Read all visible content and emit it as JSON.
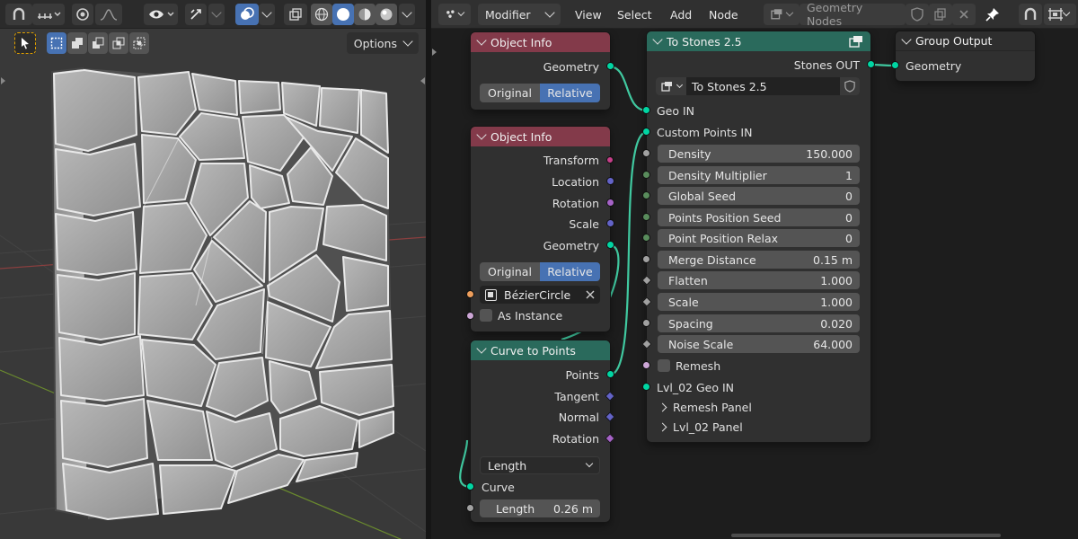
{
  "viewport": {
    "options_label": "Options",
    "colors": {
      "bg": "#393939",
      "header": "#2b2b2b",
      "stone": "#a7a7a7",
      "stone_edge": "#e9e9e9",
      "crack": "#404040"
    },
    "header_icons": [
      "magnet-icon",
      "snap-increment-icon",
      "proportional-edit-icon",
      "falloff-icon",
      "view-object-types-icon",
      "gizmo-icon",
      "overlays-icon",
      "xray-icon",
      "wireframe-shading-icon",
      "solid-shading-icon",
      "material-shading-icon",
      "rendered-shading-icon"
    ],
    "tool_icons": [
      "select-cursor-icon",
      "mode-new-icon",
      "mode-extend-icon",
      "mode-subtract-icon",
      "mode-difference-icon",
      "mode-intersect-icon"
    ]
  },
  "node_editor": {
    "header": {
      "editor_type_icon": "node-editor-icon",
      "mode": "Modifier",
      "menus": [
        "View",
        "Select",
        "Add",
        "Node"
      ],
      "node_group": "Geometry Nodes",
      "pin_icon": "pin-icon"
    },
    "colors": {
      "object_info": "#833a4a",
      "geometry": "#2a6a5c",
      "wire": "#40c9a0",
      "geometry_socket": "#00d6a3",
      "float_socket": "#a1a1a1",
      "int_socket": "#598c5c",
      "vector_socket": "#6363c7",
      "rotation_socket": "#a663c7",
      "matrix_socket": "#c73f8a",
      "object_socket": "#ed9e5c",
      "bool_socket": "#cca6d6",
      "accent": "#4772b3"
    },
    "object_info_1": {
      "title": "Object Info",
      "outputs": [
        "Geometry"
      ],
      "toggle": [
        "Original",
        "Relative"
      ]
    },
    "object_info_2": {
      "title": "Object Info",
      "outputs": [
        "Transform",
        "Location",
        "Rotation",
        "Scale",
        "Geometry"
      ],
      "toggle": [
        "Original",
        "Relative"
      ],
      "object_value": "BézierCircle",
      "as_instance_label": "As Instance"
    },
    "curve_to_points": {
      "title": "Curve to Points",
      "outputs": [
        "Points",
        "Tangent",
        "Normal",
        "Rotation"
      ],
      "mode_select": "Length",
      "curve_input": "Curve",
      "length_label": "Length",
      "length_value": "0.26 m"
    },
    "to_stones": {
      "title": "To Stones 2.5",
      "output": "Stones OUT",
      "group_name": "To Stones 2.5",
      "geo_in": "Geo IN",
      "custom_points_in": "Custom Points IN",
      "fields": [
        {
          "label": "Density",
          "value": "150.000"
        },
        {
          "label": "Density Multiplier",
          "value": "1"
        },
        {
          "label": "Global Seed",
          "value": "0"
        },
        {
          "label": "Points Position Seed",
          "value": "0"
        },
        {
          "label": "Point Position Relax",
          "value": "0"
        },
        {
          "label": "Merge Distance",
          "value": "0.15 m"
        },
        {
          "label": "Flatten",
          "value": "1.000"
        },
        {
          "label": "Scale",
          "value": "1.000"
        },
        {
          "label": "Spacing",
          "value": "0.020"
        },
        {
          "label": "Noise Scale",
          "value": "64.000"
        }
      ],
      "remesh_label": "Remesh",
      "lvl_geo_in": "Lvl_02 Geo IN",
      "panels": [
        "Remesh Panel",
        "Lvl_02 Panel"
      ]
    },
    "group_output": {
      "title": "Group Output",
      "input": "Geometry"
    }
  }
}
